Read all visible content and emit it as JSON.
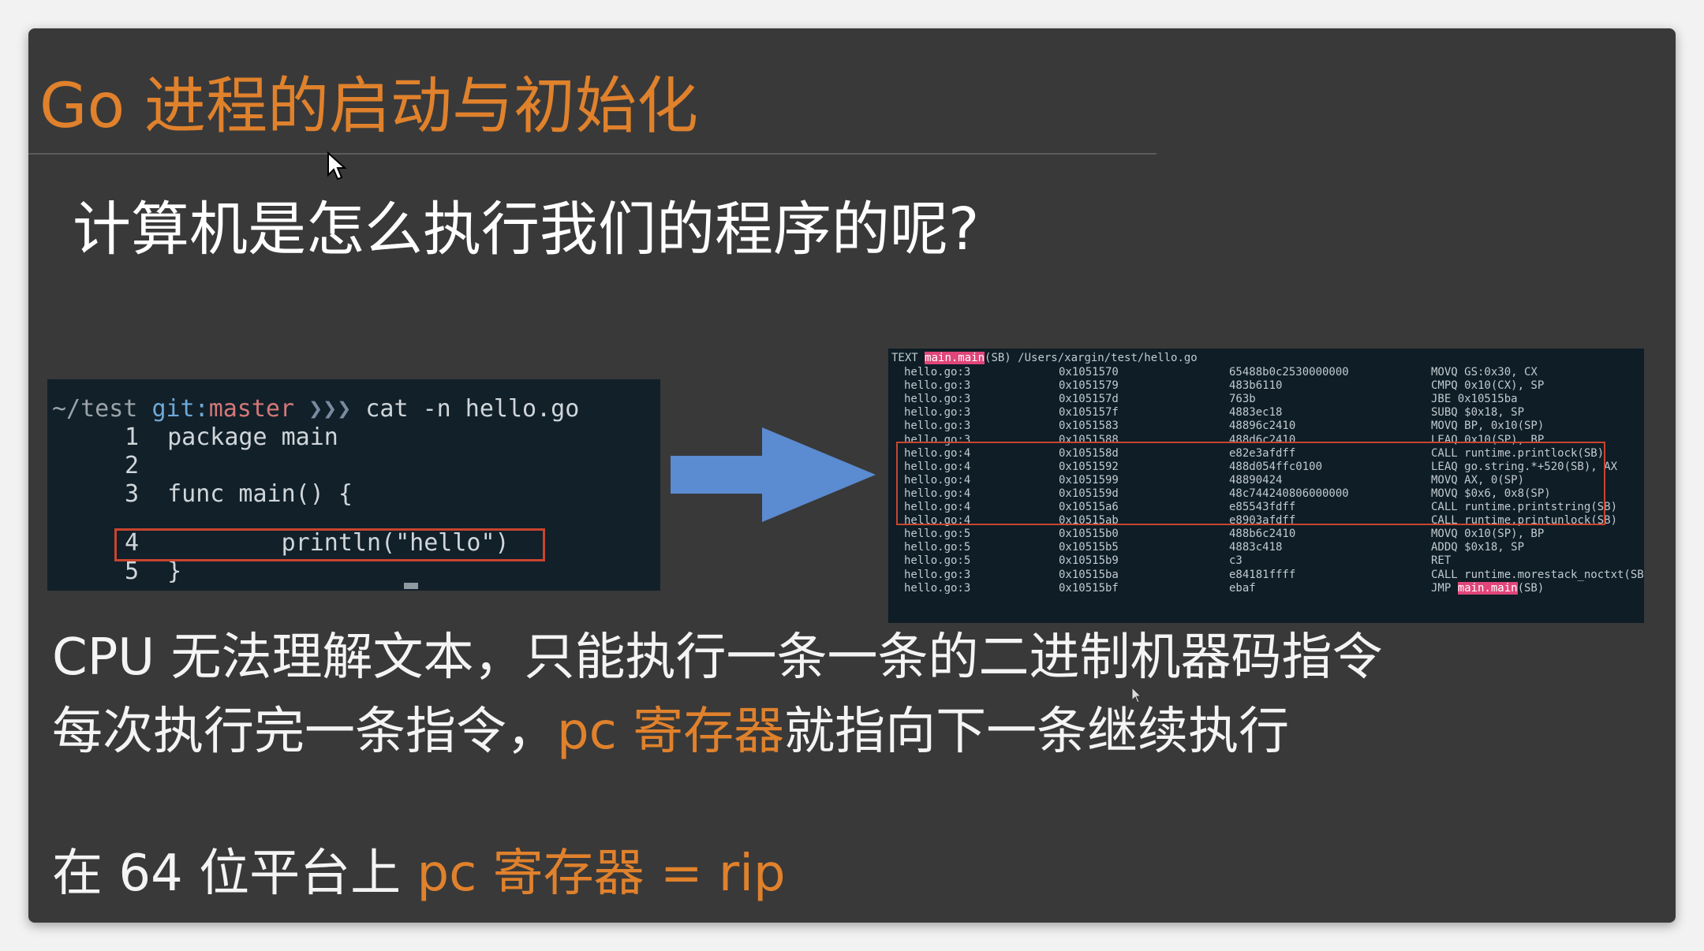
{
  "slide": {
    "title": "Go 进程的启动与初始化",
    "question": "计算机是怎么执行我们的程序的呢?"
  },
  "terminal": {
    "prompt_path": "~/test",
    "prompt_git": "git:",
    "prompt_branch": "master",
    "prompt_arrows": "❯❯❯",
    "command": "cat -n hello.go",
    "lines": [
      {
        "num": "1",
        "code": "package main"
      },
      {
        "num": "2",
        "code": ""
      },
      {
        "num": "3",
        "code": "func main() {"
      },
      {
        "num": "4",
        "code": "        println(\"hello\")"
      },
      {
        "num": "5",
        "code": "}"
      }
    ]
  },
  "assembly": {
    "header_prefix": "TEXT ",
    "header_symbol": "main.main",
    "header_suffix": "(SB) /Users/xargin/test/hello.go",
    "rows": [
      {
        "file": "hello.go:3",
        "addr": "0x1051570",
        "bytes": "65488b0c2530000000",
        "instr": "MOVQ GS:0x30, CX"
      },
      {
        "file": "hello.go:3",
        "addr": "0x1051579",
        "bytes": "483b6110",
        "instr": "CMPQ 0x10(CX), SP"
      },
      {
        "file": "hello.go:3",
        "addr": "0x105157d",
        "bytes": "763b",
        "instr": "JBE 0x10515ba"
      },
      {
        "file": "hello.go:3",
        "addr": "0x105157f",
        "bytes": "4883ec18",
        "instr": "SUBQ $0x18, SP"
      },
      {
        "file": "hello.go:3",
        "addr": "0x1051583",
        "bytes": "48896c2410",
        "instr": "MOVQ BP, 0x10(SP)"
      },
      {
        "file": "hello.go:3",
        "addr": "0x1051588",
        "bytes": "488d6c2410",
        "instr": "LEAQ 0x10(SP), BP"
      },
      {
        "file": "hello.go:4",
        "addr": "0x105158d",
        "bytes": "e82e3afdff",
        "instr": "CALL runtime.printlock(SB)"
      },
      {
        "file": "hello.go:4",
        "addr": "0x1051592",
        "bytes": "488d054ffc0100",
        "instr": "LEAQ go.string.*+520(SB), AX"
      },
      {
        "file": "hello.go:4",
        "addr": "0x1051599",
        "bytes": "48890424",
        "instr": "MOVQ AX, 0(SP)"
      },
      {
        "file": "hello.go:4",
        "addr": "0x105159d",
        "bytes": "48c744240806000000",
        "instr": "MOVQ $0x6, 0x8(SP)"
      },
      {
        "file": "hello.go:4",
        "addr": "0x10515a6",
        "bytes": "e85543fdff",
        "instr": "CALL runtime.printstring(SB)"
      },
      {
        "file": "hello.go:4",
        "addr": "0x10515ab",
        "bytes": "e8903afdff",
        "instr": "CALL runtime.printunlock(SB)"
      },
      {
        "file": "hello.go:5",
        "addr": "0x10515b0",
        "bytes": "488b6c2410",
        "instr": "MOVQ 0x10(SP), BP"
      },
      {
        "file": "hello.go:5",
        "addr": "0x10515b5",
        "bytes": "4883c418",
        "instr": "ADDQ $0x18, SP"
      },
      {
        "file": "hello.go:5",
        "addr": "0x10515b9",
        "bytes": "c3",
        "instr": "RET"
      },
      {
        "file": "hello.go:3",
        "addr": "0x10515ba",
        "bytes": "e84181ffff",
        "instr": "CALL runtime.morestack_noctxt(SB)"
      },
      {
        "file": "hello.go:3",
        "addr": "0x10515bf",
        "bytes": "ebaf",
        "instr": "JMP "
      }
    ],
    "last_symbol": "main.main",
    "last_suffix": "(SB)"
  },
  "text": {
    "line1": "CPU 无法理解文本，只能执行一条一条的二进制机器码指令",
    "line2_a": "每次执行完一条指令，",
    "line2_b": "pc 寄存器",
    "line2_c": "就指向下一条继续执行",
    "line3_a": "在 64 位平台上 ",
    "line3_b": "pc 寄存器 = rip"
  },
  "colors": {
    "accent": "#e0812c",
    "slide_bg": "#393939",
    "highlight_box": "#c8452e",
    "arrow": "#5b8bd0",
    "symbol_highlight": "#e0467a"
  }
}
